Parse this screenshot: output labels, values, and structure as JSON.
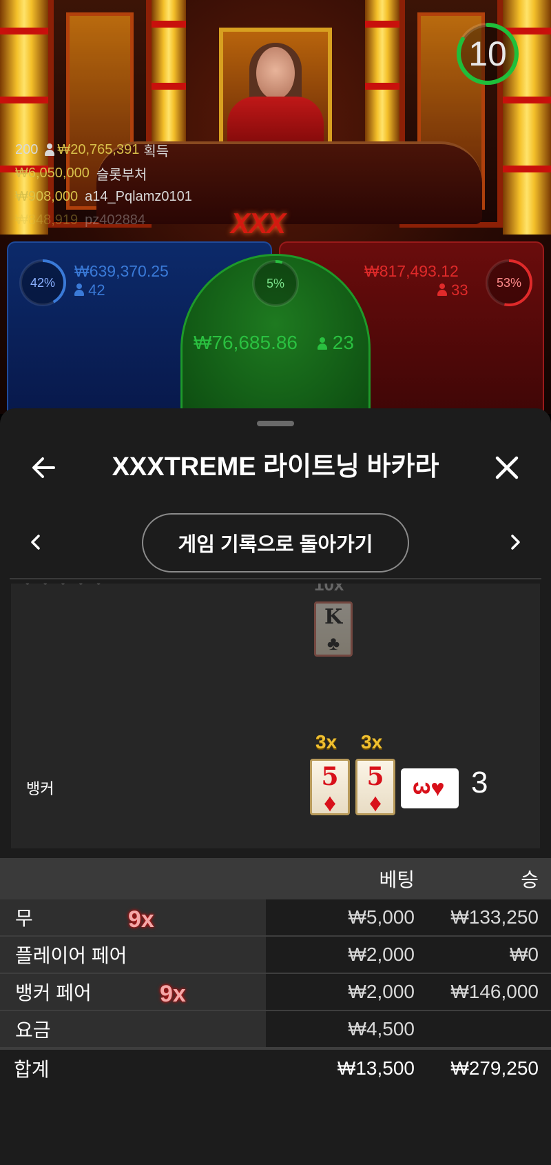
{
  "timer": {
    "value": "10",
    "color": "#1fbf3a"
  },
  "winners": {
    "total_count": "200",
    "total_amount": "₩20,765,391",
    "total_suffix": "획득",
    "rows": [
      {
        "amount": "₩6,050,000",
        "name": "슬롯부처"
      },
      {
        "amount": "₩908,000",
        "name": "a14_Pqlamz0101"
      },
      {
        "amount": "₩848,919",
        "name": "pz402884"
      }
    ]
  },
  "table_logo": "XXX",
  "spots": {
    "player": {
      "percent": "42%",
      "amount": "₩639,370.25",
      "count": "42",
      "color": "#3a7ad8"
    },
    "tie": {
      "percent": "5%",
      "amount": "₩76,685.86",
      "count": "23",
      "color": "#2ac040"
    },
    "banker": {
      "percent": "53%",
      "amount": "₩817,493.12",
      "count": "33",
      "color": "#e02a2a"
    }
  },
  "sheet": {
    "title": "XXXTREME 라이트닝 바카라",
    "back_to_history": "게임 기록으로 돌아가기"
  },
  "results": {
    "faded_label": "• • • • •",
    "faded_multiplier": "10x",
    "prev_card": {
      "rank": "K",
      "suit": "♣"
    },
    "banker_label": "뱅커",
    "banker_cards": [
      {
        "rank": "5",
        "suit": "♦",
        "multiplier": "3x"
      },
      {
        "rank": "5",
        "suit": "♦",
        "multiplier": "3x"
      },
      {
        "rank": "3",
        "suit": "♥"
      }
    ],
    "banker_score": "3"
  },
  "bets": {
    "headers": {
      "bet": "베팅",
      "win": "승"
    },
    "rows": [
      {
        "label": "무",
        "multiplier": "9x",
        "bet": "₩5,000",
        "win": "₩133,250"
      },
      {
        "label": "플레이어 페어",
        "multiplier": "",
        "bet": "₩2,000",
        "win": "₩0"
      },
      {
        "label": "뱅커 페어",
        "multiplier": "9x",
        "bet": "₩2,000",
        "win": "₩146,000"
      },
      {
        "label": "요금",
        "multiplier": "",
        "bet": "₩4,500",
        "win": ""
      }
    ],
    "total": {
      "label": "합계",
      "bet": "₩13,500",
      "win": "₩279,250"
    }
  }
}
